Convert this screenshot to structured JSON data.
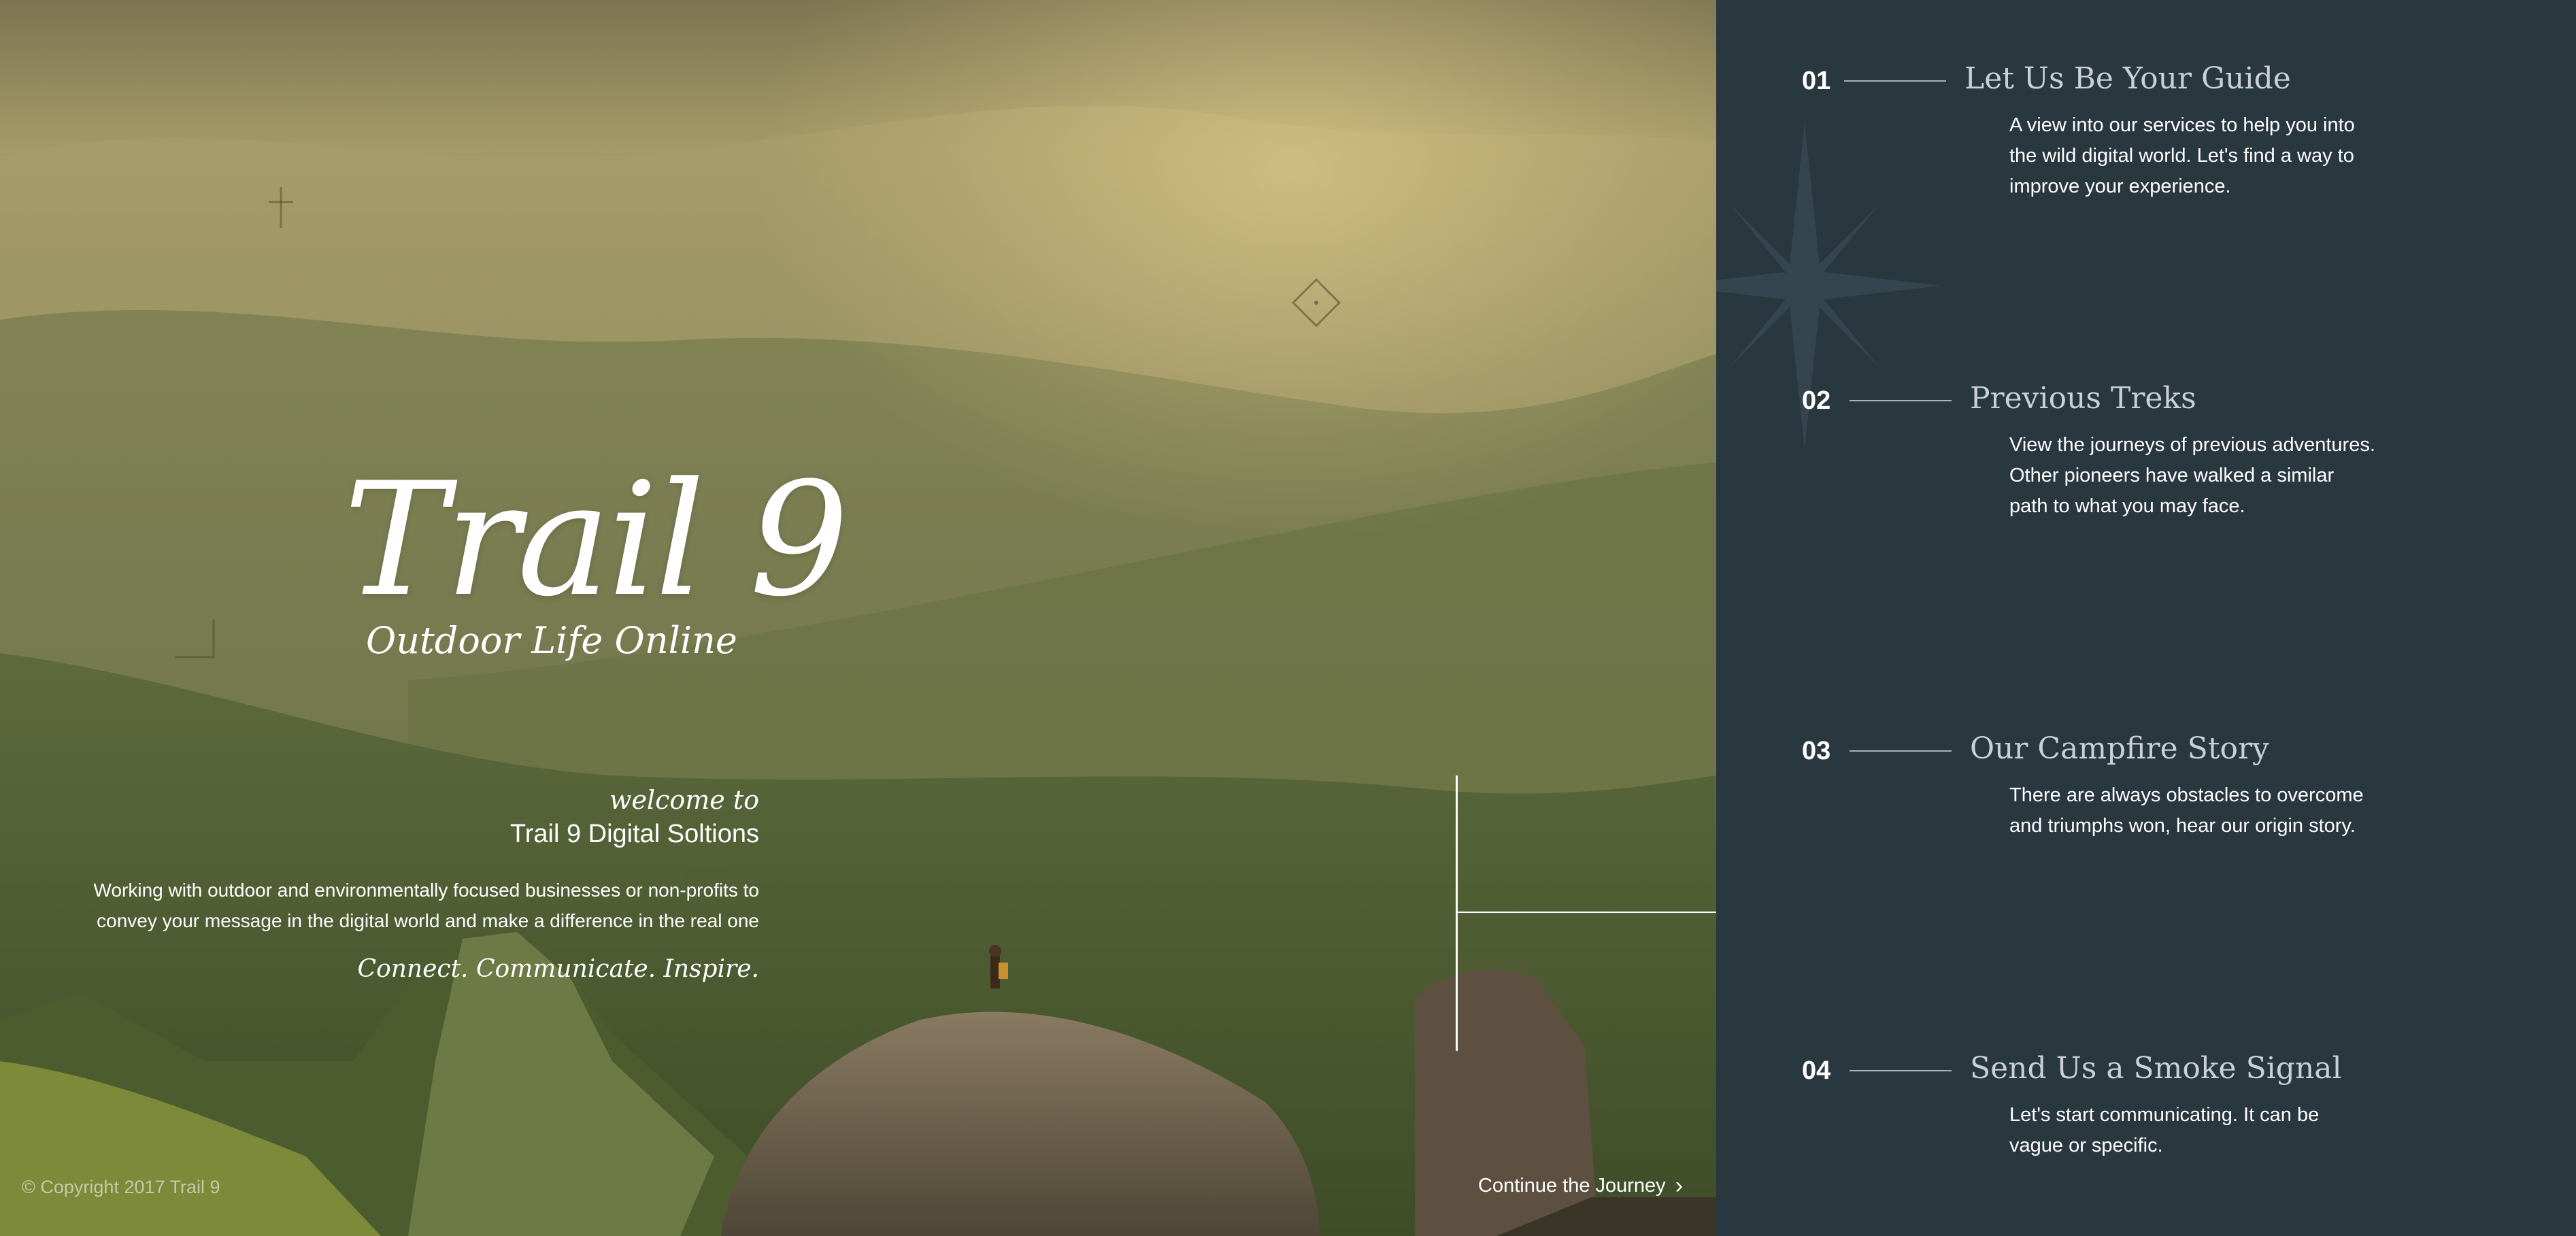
{
  "hero": {
    "title": "Trail 9",
    "subtitle": "Outdoor Life Online",
    "welcome_pre": "welcome to",
    "welcome_name": "Trail 9 Digital Soltions",
    "welcome_body": "Working with outdoor and environmentally focused businesses or non-profits to convey your message in the digital world and make a difference in the real one",
    "tagline": "Connect. Communicate. Inspire.",
    "copyright": "© Copyright 2017 Trail 9",
    "continue_label": "Continue the Journey",
    "continue_icon": "chevron-right-icon"
  },
  "nav": {
    "items": [
      {
        "number": "01",
        "title": "Let Us Be Your Guide",
        "description": "A view into our services to help you into the wild digital world. Let's find a way to improve your experience."
      },
      {
        "number": "02",
        "title": "Previous Treks",
        "description": "View the journeys of previous adventures. Other pioneers have walked a similar path to what you may face."
      },
      {
        "number": "03",
        "title": "Our Campfire Story",
        "description": "There are always obstacles to overcome and triumphs won, hear our origin story."
      },
      {
        "number": "04",
        "title": "Send Us a Smoke Signal",
        "description": "Let's start communicating. It can be vague or specific."
      }
    ]
  },
  "colors": {
    "panel_bg": "#29373f",
    "nav_title": "#c9d1d5",
    "text_light": "#ffffff"
  }
}
